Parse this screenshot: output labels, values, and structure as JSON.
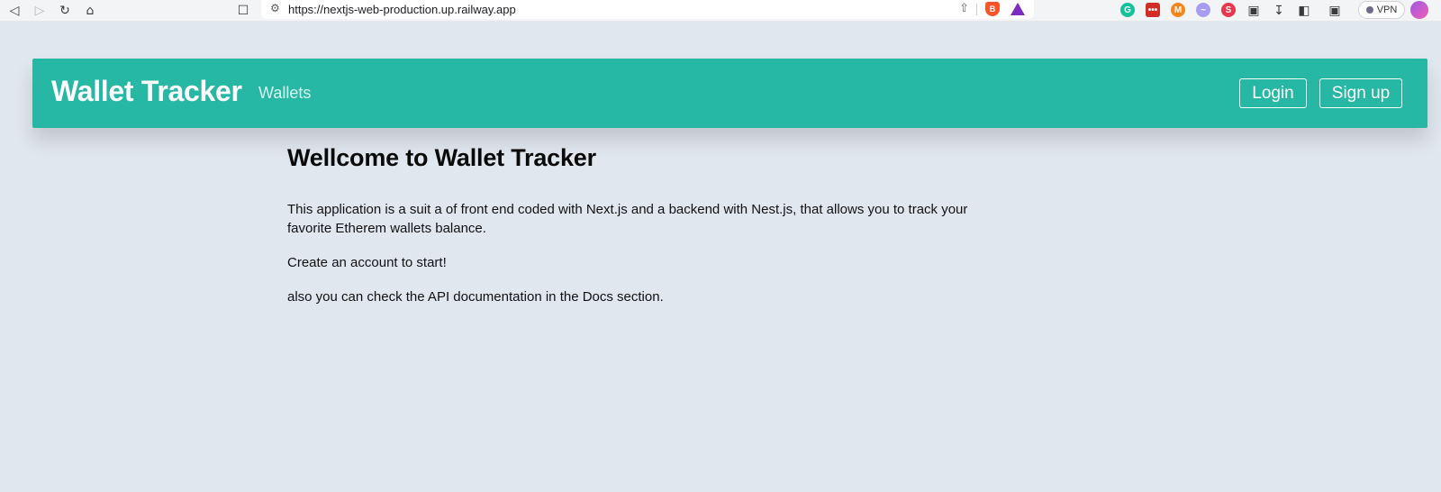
{
  "browser": {
    "url": "https://nextjs-web-production.up.railway.app",
    "vpn_label": "VPN",
    "nav_icons": [
      "back-icon",
      "forward-icon",
      "reload-icon",
      "home-icon",
      "bookmark-icon"
    ],
    "extensions": [
      "grammarly-icon",
      "lastpass-icon",
      "metamask-icon",
      "extension-icon",
      "extension-icon",
      "puzzle-icon",
      "download-icon",
      "sidebar-icon",
      "wallet-icon"
    ]
  },
  "navbar": {
    "brand": "Wallet Tracker",
    "link": "Wallets",
    "login_label": "Login",
    "signup_label": "Sign up",
    "bg_color": "#26b8a5"
  },
  "main": {
    "heading": "Wellcome to Wallet Tracker",
    "paragraphs": [
      "This application is a suit a of front end coded with Next.js and a backend with Nest.js, that allows you to track your favorite Etherem wallets balance.",
      "Create an account to start!",
      "also you can check the API documentation in the Docs section."
    ]
  }
}
